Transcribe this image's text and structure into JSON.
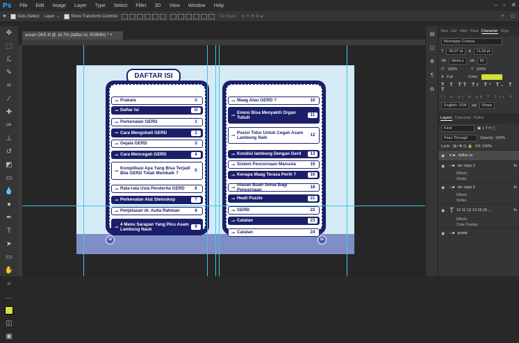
{
  "app": {
    "logo": "Ps",
    "menu": [
      "File",
      "Edit",
      "Image",
      "Layer",
      "Type",
      "Select",
      "Filter",
      "3D",
      "View",
      "Window",
      "Help"
    ],
    "win_controls": [
      "–",
      "▫",
      "✕"
    ]
  },
  "options_bar": {
    "auto_select": "Auto-Select:",
    "layer_select": "Layer",
    "show_transform": "Show Transform Controls",
    "mode3d": "3D Mode:"
  },
  "document": {
    "tab_title": "ansan OKE.tif @ 16,7% (daftar isi, RGB/8#) *",
    "close": "×",
    "title": "DAFTAR ISI",
    "page_left": "iii",
    "page_right": "iv",
    "left_items": [
      {
        "label": "Prakata",
        "page": "ii",
        "style": "white"
      },
      {
        "label": "Daftar Isi",
        "page": "iii",
        "style": "navy"
      },
      {
        "label": "Perkenalan GERD",
        "page": "1",
        "style": "white"
      },
      {
        "label": "Cara Mengobati GERD",
        "page": "2",
        "style": "navy"
      },
      {
        "label": "Gejala GERD",
        "page": "3",
        "style": "white"
      },
      {
        "label": "Cara Mencegah GERD",
        "page": "4",
        "style": "navy"
      },
      {
        "label": "Komplikasi Apa Yang Bisa Terjadi Bila GERD Tidak Membaik ?",
        "page": "5",
        "style": "white"
      },
      {
        "label": "Rata-rata Usia Penderita GERD",
        "page": "6",
        "style": "white"
      },
      {
        "label": "Perkenalan Alat Stetoskop",
        "page": "7",
        "style": "navy"
      },
      {
        "label": "Penjelasan dr. Aulia Rahman",
        "page": "8",
        "style": "white"
      },
      {
        "label": "4 Menu Sarapan Yang Picu Asam Lambung Nauk",
        "page": "9",
        "style": "navy"
      }
    ],
    "right_items": [
      {
        "label": "Maag Atau GERD ?",
        "page": "10",
        "style": "white"
      },
      {
        "label": "Emosi Bisa Menyakiti Organ Tubuh",
        "page": "11",
        "style": "navy"
      },
      {
        "label": "Posisi Tidur Untuk Cegah Asam Lambung Naik",
        "page": "12",
        "style": "white"
      },
      {
        "label": "Kondisi lambung Dengan Gerd",
        "page": "13",
        "style": "navy"
      },
      {
        "label": "Sistem Pencernaan Manusia",
        "page": "15",
        "style": "white"
      },
      {
        "label": "Kenapa Maag Terasa Perih ?",
        "page": "16",
        "style": "navy"
      },
      {
        "label": "Alasan Buah Sehat Bagi Pencernaan",
        "page": "18",
        "style": "white"
      },
      {
        "label": "Healt Puzzle",
        "page": "21",
        "style": "navy"
      },
      {
        "label": "GERD",
        "page": "22",
        "style": "white"
      },
      {
        "label": "Catatan",
        "page": "23",
        "style": "navy"
      },
      {
        "label": "Catatan",
        "page": "24",
        "style": "white"
      }
    ]
  },
  "character_panel": {
    "tabs": [
      "Swa",
      "Libr",
      "Adju",
      "Para",
      "Character",
      "Glyp"
    ],
    "font": "Monotype Corsiva",
    "size": "65,07 pt",
    "leading": "11,39 pt",
    "kerning": "Metrics",
    "tracking": "60",
    "vscale": "100%",
    "hscale": "100%",
    "baseline": "0 pt",
    "color_label": "Color:",
    "color": "#d7e03a",
    "language": "English: USA",
    "aa": "Sharp"
  },
  "layers_panel": {
    "tabs": [
      "Layers",
      "Channels",
      "Paths"
    ],
    "kind": "Kind",
    "blend": "Pass Through",
    "opacity": "Opacity: 100%",
    "lock": "Lock:",
    "fill": "Fill: 100%",
    "layers": [
      {
        "name": "daftar isi",
        "type": "folder"
      },
      {
        "name": "mc copy 2",
        "type": "folder"
      },
      {
        "name": "mc copy 2",
        "type": "folder"
      },
      {
        "name": "10 11 12 13 15 16 ...",
        "type": "text"
      },
      {
        "name": "posisi",
        "type": "folder"
      }
    ],
    "effects": "Effects",
    "stroke": "Stroke",
    "color_overlay": "Color Overlay"
  }
}
